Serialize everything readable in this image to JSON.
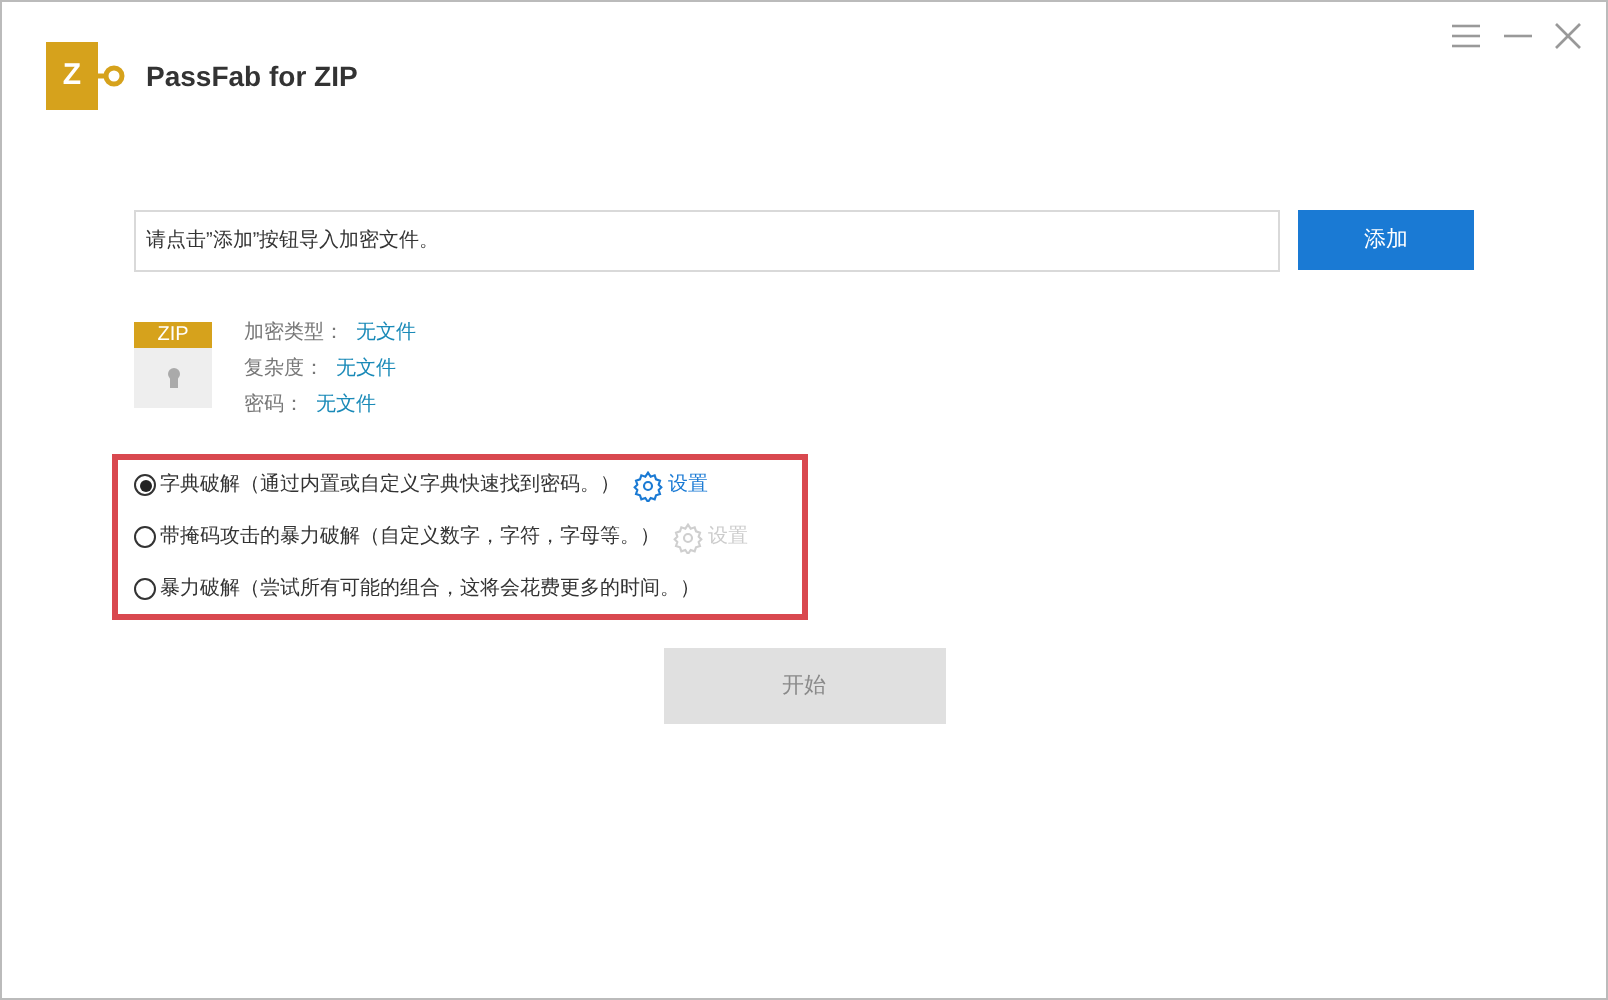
{
  "app": {
    "logo_letter": "Z",
    "title": "PassFab for ZIP"
  },
  "file_field": {
    "placeholder": "请点击”添加”按钮导入加密文件。"
  },
  "add_button": {
    "label": "添加"
  },
  "file_info": {
    "badge": "ZIP",
    "rows": [
      {
        "label": "加密类型：",
        "value": "无文件"
      },
      {
        "label": "复杂度：",
        "value": "无文件"
      },
      {
        "label": "密码：",
        "value": "无文件"
      }
    ]
  },
  "attack_modes": [
    {
      "label": "字典破解（通过内置或自定义字典快速找到密码。）",
      "selected": true,
      "settings": {
        "label": "设置",
        "disabled": false
      }
    },
    {
      "label": "带掩码攻击的暴力破解（自定义数字，字符，字母等。）",
      "selected": false,
      "settings": {
        "label": "设置",
        "disabled": true
      }
    },
    {
      "label": "暴力破解（尝试所有可能的组合，这将会花费更多的时间。）",
      "selected": false
    }
  ],
  "start_button": {
    "label": "开始",
    "disabled": true
  }
}
